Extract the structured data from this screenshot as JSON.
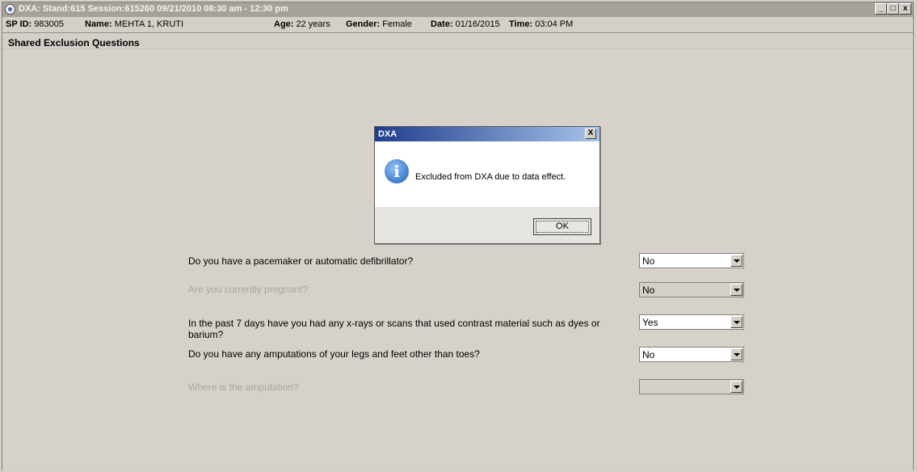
{
  "window": {
    "title": "DXA: Stand:615 Session:615260 09/21/2010 08:30 am - 12:30 pm",
    "minimize_label": "_",
    "maximize_label": "□",
    "close_label": "x"
  },
  "info": {
    "sp_id_label": "SP ID:",
    "sp_id": "983005",
    "name_label": "Name:",
    "name": "MEHTA 1, KRUTI",
    "age_label": "Age:",
    "age": "22 years",
    "gender_label": "Gender:",
    "gender": "Female",
    "date_label": "Date:",
    "date": "01/16/2015",
    "time_label": "Time:",
    "time": "03:04 PM"
  },
  "section_title": "Shared Exclusion Questions",
  "questions": [
    {
      "text": "Do you have a pacemaker or automatic defibrillator?",
      "value": "No",
      "enabled": true
    },
    {
      "text": "Are you currently pregnant?",
      "value": "No",
      "enabled": false
    },
    {
      "text": "In the past 7 days have you had any x-rays or scans that used contrast material such as dyes or barium?",
      "value": "Yes",
      "enabled": true
    },
    {
      "text": "Do you have any amputations of your legs and feet other than toes?",
      "value": "No",
      "enabled": true
    },
    {
      "text": "Where is the amputation?",
      "value": "",
      "enabled": false
    }
  ],
  "dialog": {
    "title": "DXA",
    "close_label": "X",
    "icon": "info-icon",
    "icon_glyph": "i",
    "message": "Excluded from DXA due to data effect.",
    "ok_label": "OK"
  }
}
